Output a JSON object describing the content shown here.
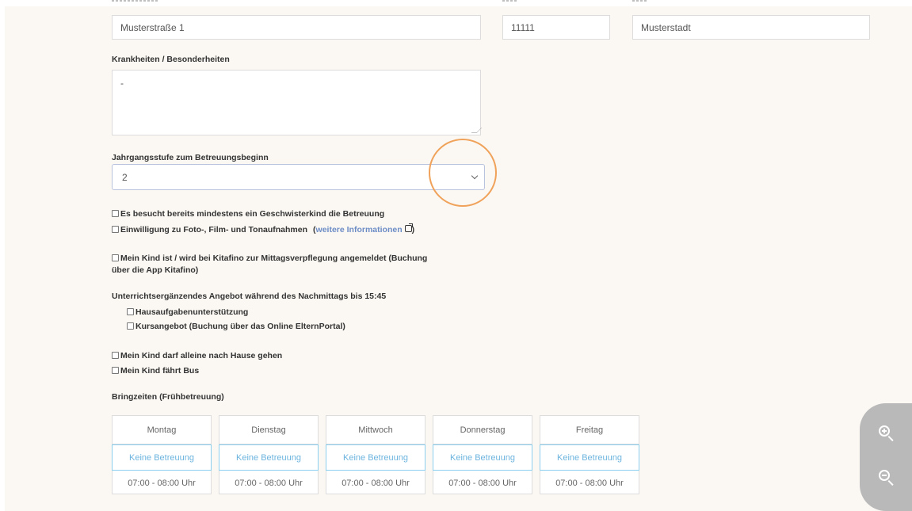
{
  "address": {
    "street_value": "Musterstraße 1",
    "zip_value": "11111",
    "city_value": "Musterstadt"
  },
  "illness": {
    "label": "Krankheiten / Besonderheiten",
    "value": "-"
  },
  "grade": {
    "label": "Jahrgangsstufe zum Betreuungsbeginn",
    "selected": "2"
  },
  "checkboxes": {
    "sibling": "Es besucht bereits mindestens ein Geschwisterkind die Betreuung",
    "photo_consent": "Einwilligung zu Foto-, Film- und Tonaufnahmen",
    "photo_consent_link": "weitere Informationen",
    "paren_open": "(",
    "paren_close": ")",
    "lunch_line1": "Mein Kind ist / wird bei Kitafino zur Mittagsverpflegung angemeldet (Buchung",
    "lunch_line2": "über die App Kitafino)"
  },
  "afternoon": {
    "label": "Unterrichtsergänzendes Angebot während des Nachmittags bis 15:45",
    "homework": "Hausaufgabenunterstützung",
    "course": "Kursangebot (Buchung über das Online ElternPortal)"
  },
  "home": {
    "walk_alone": "Mein Kind darf alleine nach Hause gehen",
    "bus": "Mein Kind fährt Bus"
  },
  "bring_times": {
    "label": "Bringzeiten (Frühbetreuung)",
    "days": [
      {
        "name": "Montag",
        "option": "Keine Betreuung",
        "time": "07:00 - 08:00 Uhr"
      },
      {
        "name": "Dienstag",
        "option": "Keine Betreuung",
        "time": "07:00 - 08:00 Uhr"
      },
      {
        "name": "Mittwoch",
        "option": "Keine Betreuung",
        "time": "07:00 - 08:00 Uhr"
      },
      {
        "name": "Donnerstag",
        "option": "Keine Betreuung",
        "time": "07:00 - 08:00 Uhr"
      },
      {
        "name": "Freitag",
        "option": "Keine Betreuung",
        "time": "07:00 - 08:00 Uhr"
      }
    ]
  },
  "colors": {
    "background": "#fbf8f3",
    "link": "#6c8cc6",
    "option_border": "#8ccfee",
    "highlight": "#f0a25a",
    "zoom_pill": "#b9b9b9"
  },
  "icons": {
    "zoom_in": "zoom-in-icon",
    "zoom_out": "zoom-out-icon",
    "external_link": "external-link-icon",
    "dropdown": "chevron-down-icon"
  }
}
